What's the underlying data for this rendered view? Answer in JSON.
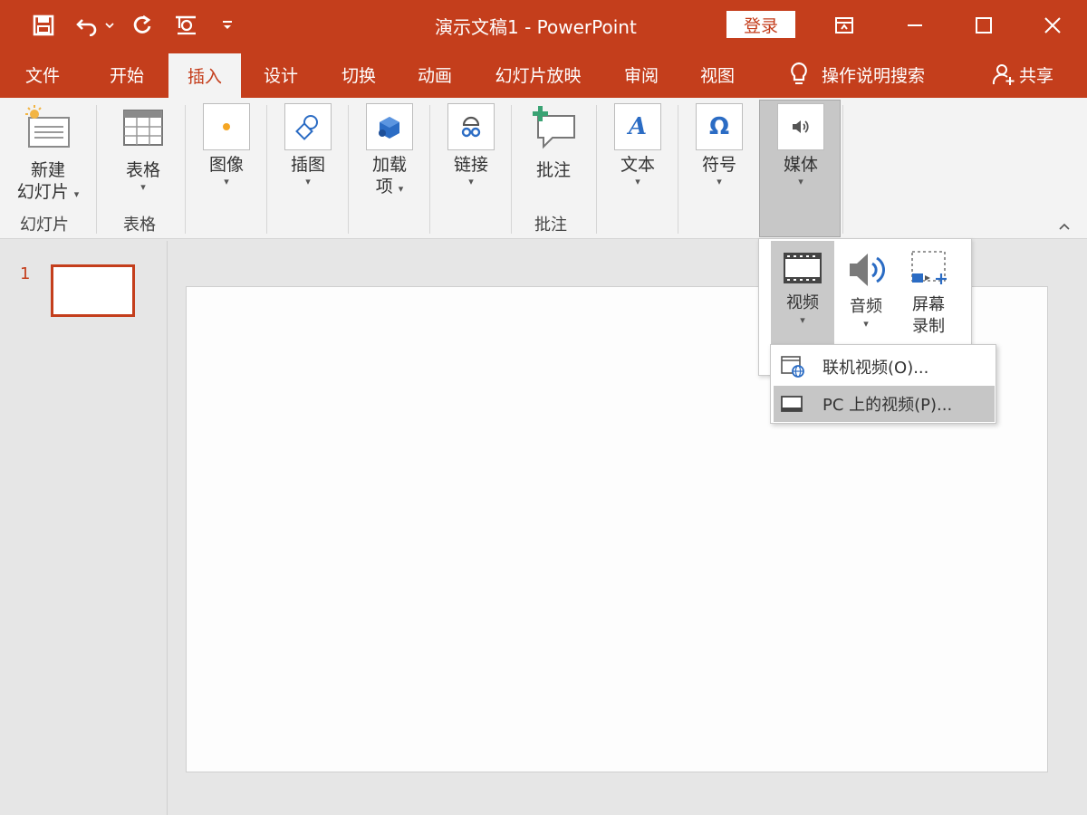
{
  "window": {
    "title": "演示文稿1  -  PowerPoint",
    "login_label": "登录"
  },
  "tabs": [
    {
      "label": "文件"
    },
    {
      "label": "开始"
    },
    {
      "label": "插入"
    },
    {
      "label": "设计"
    },
    {
      "label": "切换"
    },
    {
      "label": "动画"
    },
    {
      "label": "幻灯片放映"
    },
    {
      "label": "审阅"
    },
    {
      "label": "视图"
    },
    {
      "label": "操作说明搜索"
    },
    {
      "label": "共享"
    }
  ],
  "ribbon": {
    "new_slide": {
      "line1": "新建",
      "line2": "幻灯片"
    },
    "table": {
      "label": "表格"
    },
    "image": {
      "label": "图像"
    },
    "illustration": {
      "label": "插图"
    },
    "addins": {
      "line1": "加载",
      "line2": "项"
    },
    "link": {
      "label": "链接"
    },
    "comment": {
      "label": "批注"
    },
    "text": {
      "label": "文本"
    },
    "symbol": {
      "label": "符号"
    },
    "media": {
      "label": "媒体"
    },
    "groups": {
      "slides": "幻灯片",
      "tables": "表格",
      "comments": "批注"
    }
  },
  "slides_panel": {
    "slide_number": "1"
  },
  "media_dropdown": {
    "video": "视频",
    "audio": "音频",
    "screen_rec_line1": "屏幕",
    "screen_rec_line2": "录制"
  },
  "video_menu": {
    "online": "联机视频(O)...",
    "pc": "PC 上的视频(P)..."
  },
  "colors": {
    "accent": "#c43e1c",
    "blue_icon": "#2b6cc4"
  }
}
